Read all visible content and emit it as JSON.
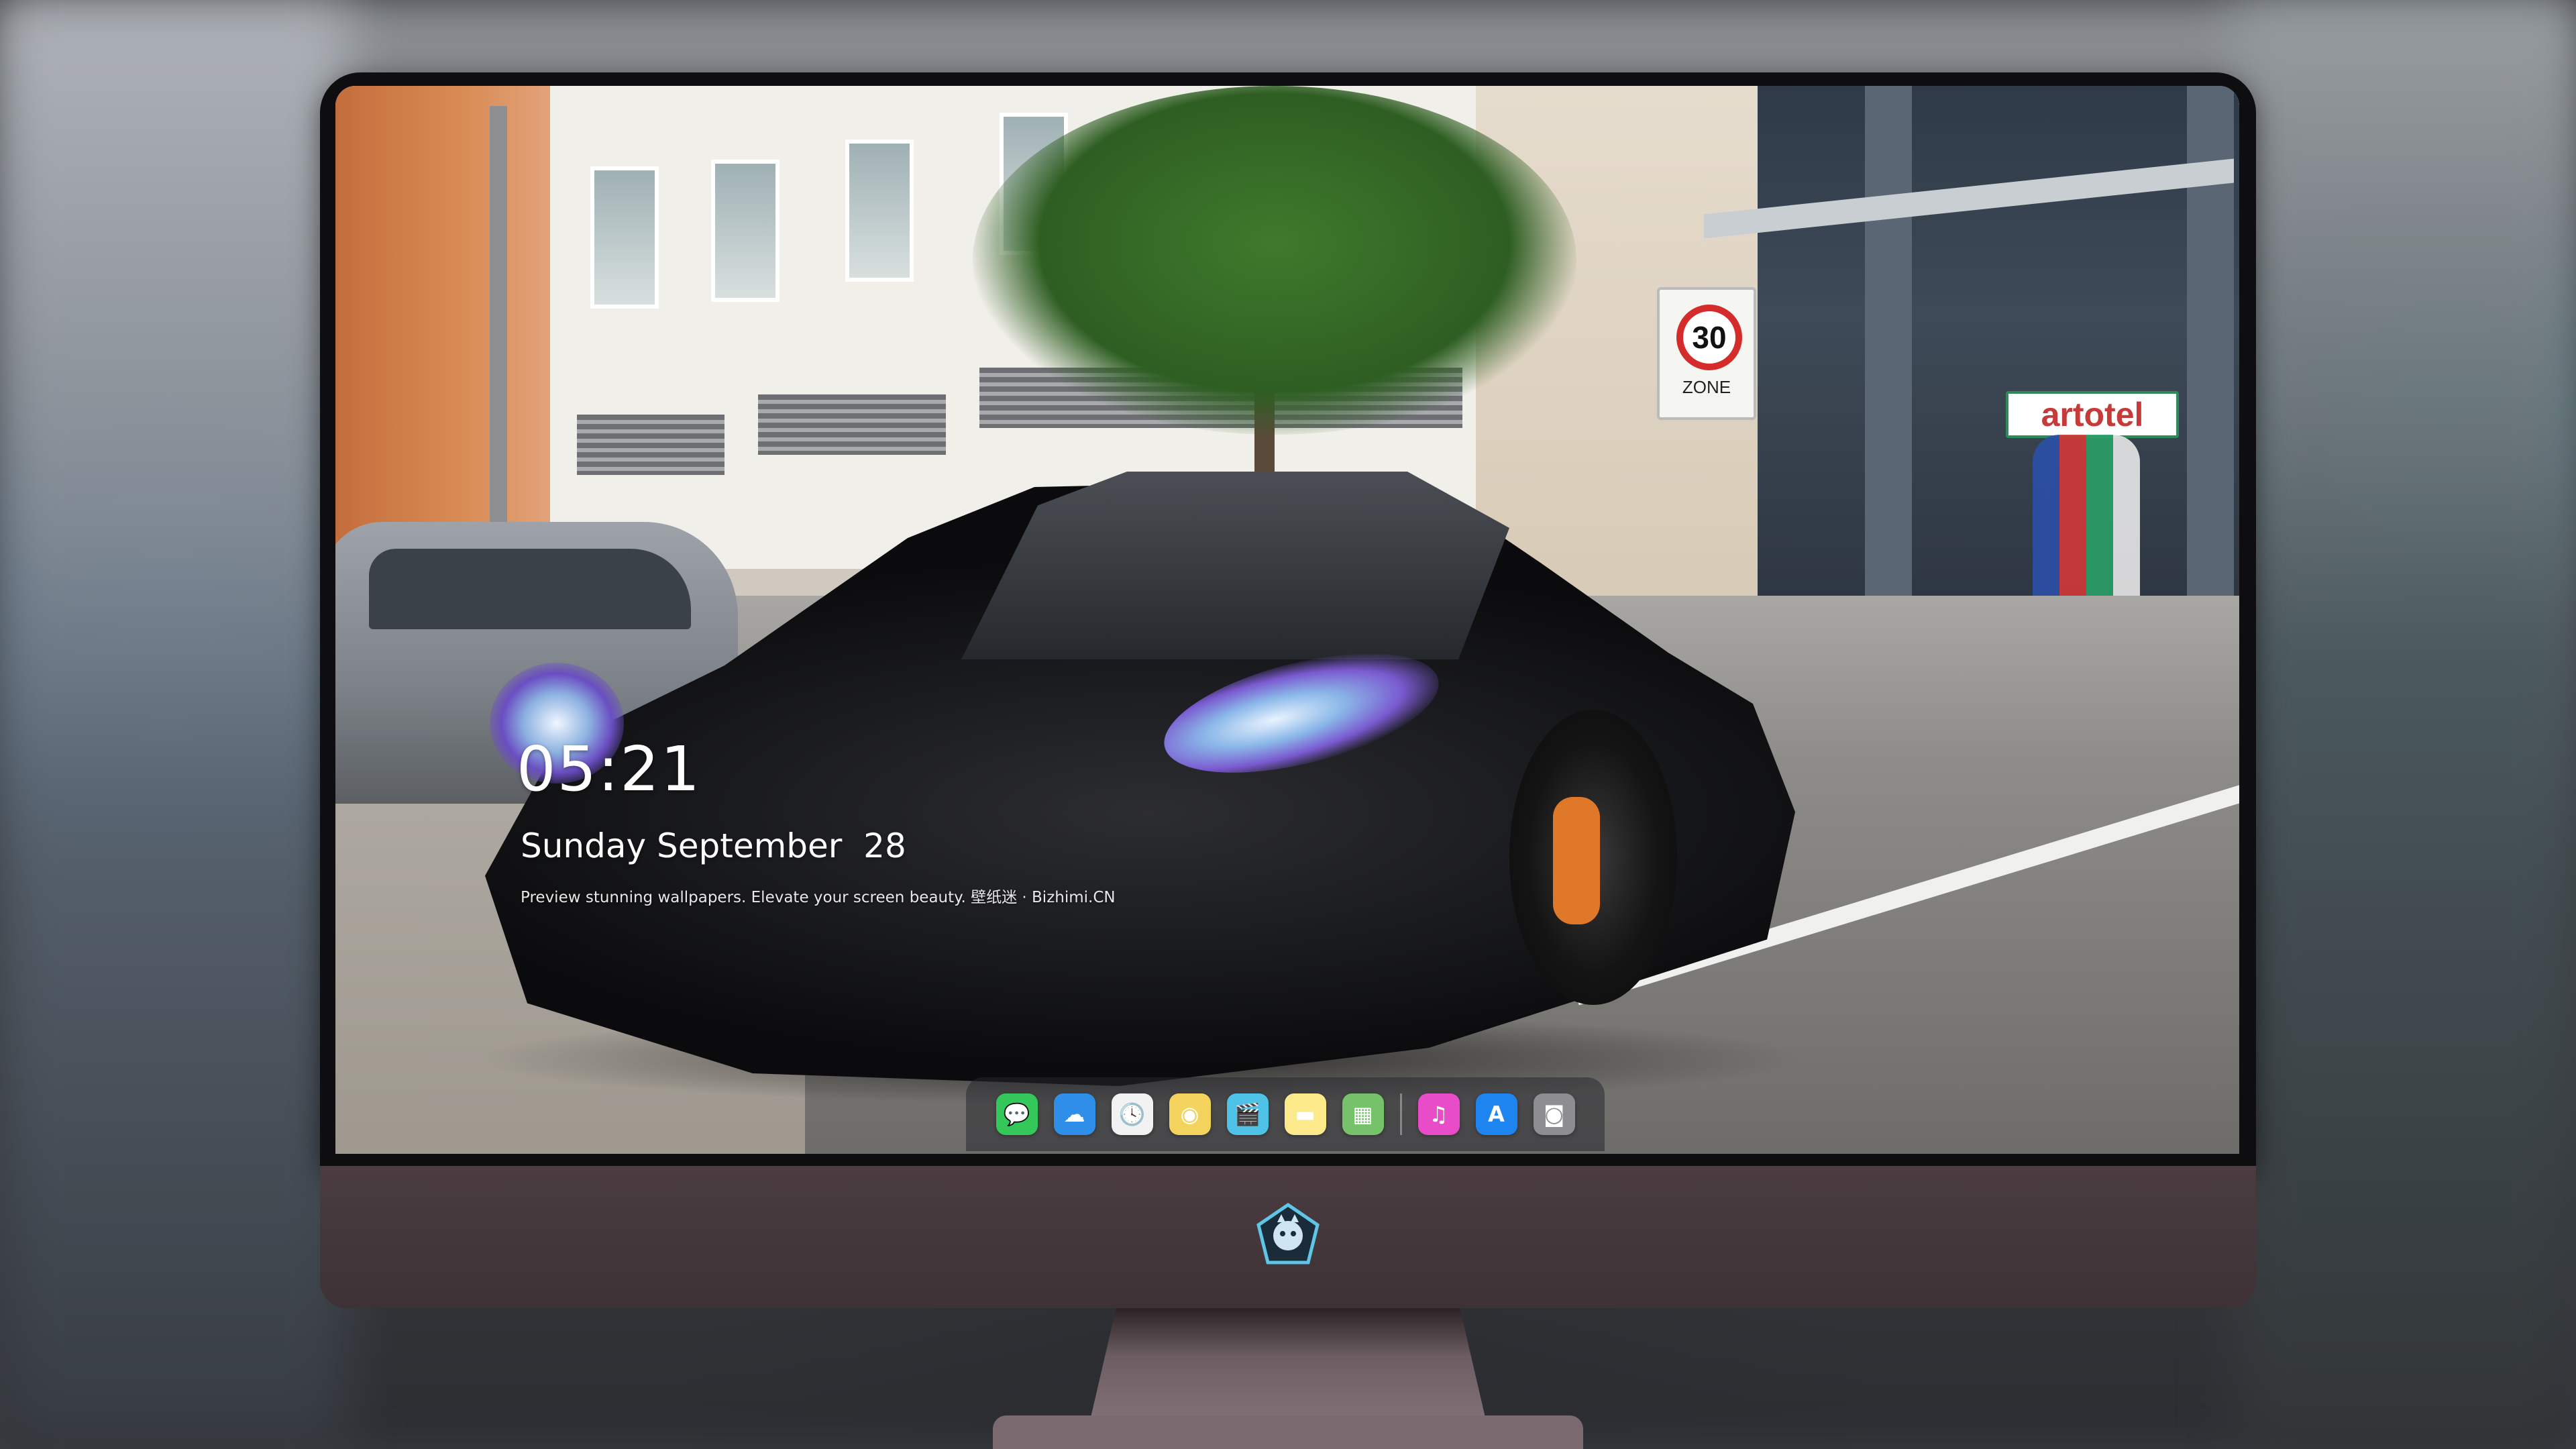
{
  "lockscreen": {
    "time": "05:21",
    "date": "Sunday September  28",
    "tagline": "Preview stunning wallpapers. Elevate your screen beauty. 壁纸迷 · Bizhimi.CN"
  },
  "wallpaper": {
    "speed_sign": "30",
    "zone_text": "ZONE",
    "hotel_sign": "artotel"
  },
  "dock": {
    "apps": [
      {
        "name": "messages-icon",
        "glyph": "💬",
        "color": "#34c759"
      },
      {
        "name": "weather-icon",
        "glyph": "☁",
        "color": "#2f8fe8"
      },
      {
        "name": "clock-icon",
        "glyph": "🕓",
        "color": "#f2f2f2"
      },
      {
        "name": "preview-icon",
        "glyph": "◉",
        "color": "#f3d35c"
      },
      {
        "name": "clips-icon",
        "glyph": "🎬",
        "color": "#4fc2e8"
      },
      {
        "name": "notes-icon",
        "glyph": "▬",
        "color": "#fbe98a"
      },
      {
        "name": "photo-gallery-icon",
        "glyph": "▦",
        "color": "#76c26b"
      },
      {
        "name": "music-icon",
        "glyph": "♫",
        "color": "#e84cc9"
      },
      {
        "name": "app-store-icon",
        "glyph": "A",
        "color": "#1e84f0"
      },
      {
        "name": "camera-icon",
        "glyph": "◙",
        "color": "#8d8d92"
      }
    ]
  },
  "colors": {
    "chin": "#4a3c40",
    "bezel": "#0e0e10",
    "accent_caliper": "#e0782a"
  }
}
